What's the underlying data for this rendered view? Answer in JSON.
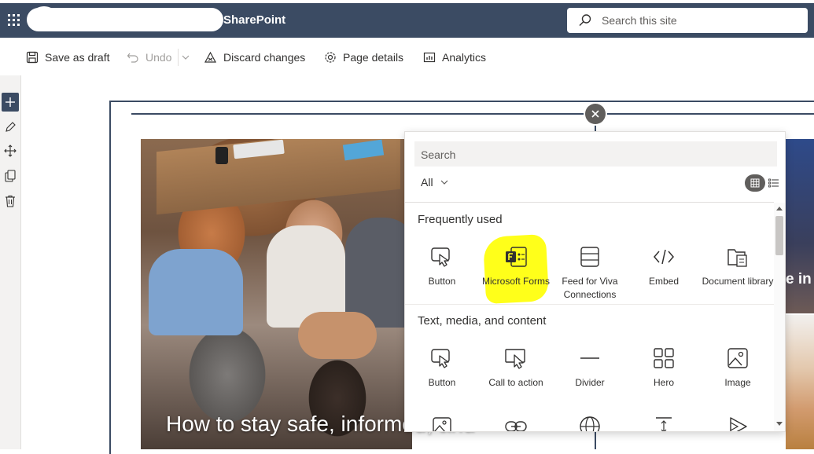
{
  "suitebar": {
    "site_name": "SharePoint",
    "search_placeholder": "Search this site",
    "color": "#3b4b63"
  },
  "commandbar": {
    "save_as_draft": "Save as draft",
    "undo": "Undo",
    "discard_changes": "Discard changes",
    "page_details": "Page details",
    "analytics": "Analytics"
  },
  "left_toolbar": {
    "icons": [
      "add-icon",
      "edit-icon",
      "move-icon",
      "duplicate-icon",
      "delete-icon"
    ]
  },
  "hero": {
    "title": "How to stay safe, informed, and",
    "right_title": "e in"
  },
  "toolbox": {
    "search_placeholder": "Search",
    "filter_label": "All",
    "sections": [
      {
        "title": "Frequently used",
        "items": [
          {
            "label": "Button",
            "icon": "button-icon"
          },
          {
            "label": "Microsoft Forms",
            "icon": "microsoft-forms-icon"
          },
          {
            "label": "Feed for Viva Connections",
            "icon": "feed-icon"
          },
          {
            "label": "Embed",
            "icon": "embed-icon"
          },
          {
            "label": "Document library",
            "icon": "document-library-icon"
          }
        ]
      },
      {
        "title": "Text, media, and content",
        "items": [
          {
            "label": "Button",
            "icon": "button-icon"
          },
          {
            "label": "Call to action",
            "icon": "call-to-action-icon"
          },
          {
            "label": "Divider",
            "icon": "divider-icon"
          },
          {
            "label": "Hero",
            "icon": "hero-icon"
          },
          {
            "label": "Image",
            "icon": "image-icon"
          }
        ]
      }
    ],
    "partial_row_icons": [
      "image-gallery-icon",
      "link-icon",
      "globe-icon",
      "spacer-icon",
      "stream-icon"
    ],
    "highlight_color": "#ffff1a"
  }
}
